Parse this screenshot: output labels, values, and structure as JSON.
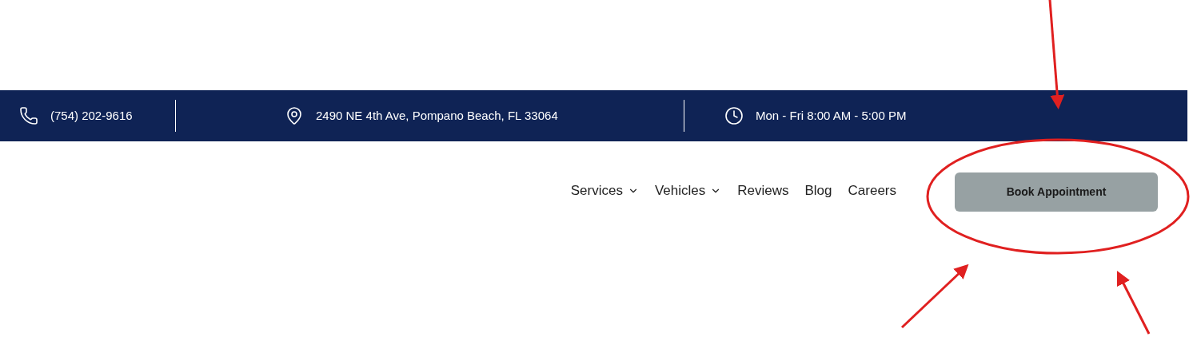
{
  "top_bar": {
    "items": [
      {
        "kind": "phone",
        "text": "(754) 202-9616"
      },
      {
        "kind": "location",
        "text": "2490 NE 4th Ave, Pompano Beach, FL 33064"
      },
      {
        "kind": "clock",
        "text": "Mon - Fri 8:00 AM - 5:00 PM"
      }
    ]
  },
  "nav": {
    "items": [
      {
        "label": "Services",
        "has_dropdown": true
      },
      {
        "label": "Vehicles",
        "has_dropdown": true
      },
      {
        "label": "Reviews",
        "has_dropdown": false
      },
      {
        "label": "Blog",
        "has_dropdown": false
      },
      {
        "label": "Careers",
        "has_dropdown": false
      }
    ],
    "button": "Book Appointment"
  }
}
